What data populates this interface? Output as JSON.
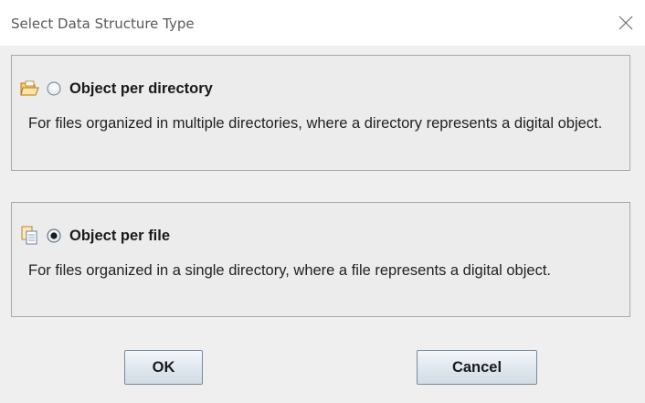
{
  "window": {
    "title": "Select Data Structure Type",
    "close_icon": "close-icon"
  },
  "options": [
    {
      "label": "Object per directory",
      "description": "For files organized in multiple directories, where a directory represents a digital object.",
      "icon": "folder-icon",
      "selected": false
    },
    {
      "label": "Object per file",
      "description": "For files organized in a single directory, where a file represents a digital object.",
      "icon": "file-copy-icon",
      "selected": true
    }
  ],
  "buttons": {
    "ok_label": "OK",
    "cancel_label": "Cancel"
  },
  "colors": {
    "panel_background": "#ececec",
    "panel_border": "#a8a8a8",
    "button_border": "#7a8a9a"
  }
}
